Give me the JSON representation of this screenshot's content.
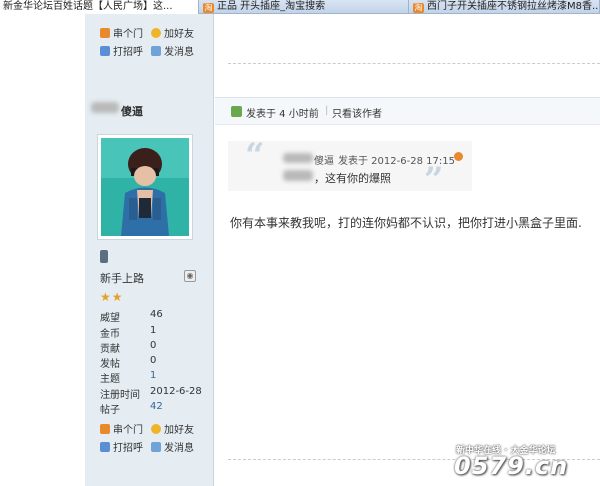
{
  "tabs": [
    {
      "label": "新金华论坛百姓话题【人民广场】这...",
      "active": true
    },
    {
      "label": "正品 开头插座_淘宝搜索",
      "active": false
    },
    {
      "label": "西门子开关插座不锈钢拉丝烤漆M8香...",
      "active": false
    }
  ],
  "top_actions": {
    "home": "串个门",
    "add_friend": "加好友",
    "poke": "打招呼",
    "message": "发消息"
  },
  "user": {
    "name_suffix": "傻逼",
    "rank": "新手上路",
    "stars": 2,
    "stats": [
      {
        "label": "威望",
        "value": "46"
      },
      {
        "label": "金币",
        "value": "1"
      },
      {
        "label": "贡献",
        "value": "0"
      },
      {
        "label": "发帖",
        "value": "0"
      },
      {
        "label": "主题",
        "value": "1"
      },
      {
        "label": "注册时间",
        "value": "2012-6-28"
      },
      {
        "label": "帖子",
        "value": "42"
      }
    ]
  },
  "bottom_actions": {
    "home": "串个门",
    "add_friend": "加好友",
    "poke": "打招呼",
    "message": "发消息"
  },
  "post": {
    "posted": "发表于 4 小时前",
    "separator": "|",
    "only_author": "只看该作者",
    "quote": {
      "author_suffix": "傻逼",
      "posted_at": "发表于 2012-6-28 17:15",
      "text": "，这有你的爆照"
    },
    "message": "你有本事来教我呢，打的连你妈都不认识，把你打进小黑盒子里面."
  },
  "watermark": {
    "line1": "新中华在线 · 大金华论坛",
    "line2": "0579.cn"
  },
  "colors": {
    "sidebar_bg": "#e5edf2",
    "link": "#336699",
    "star": "#e4a12a",
    "tab_icon": "#e8892c"
  }
}
